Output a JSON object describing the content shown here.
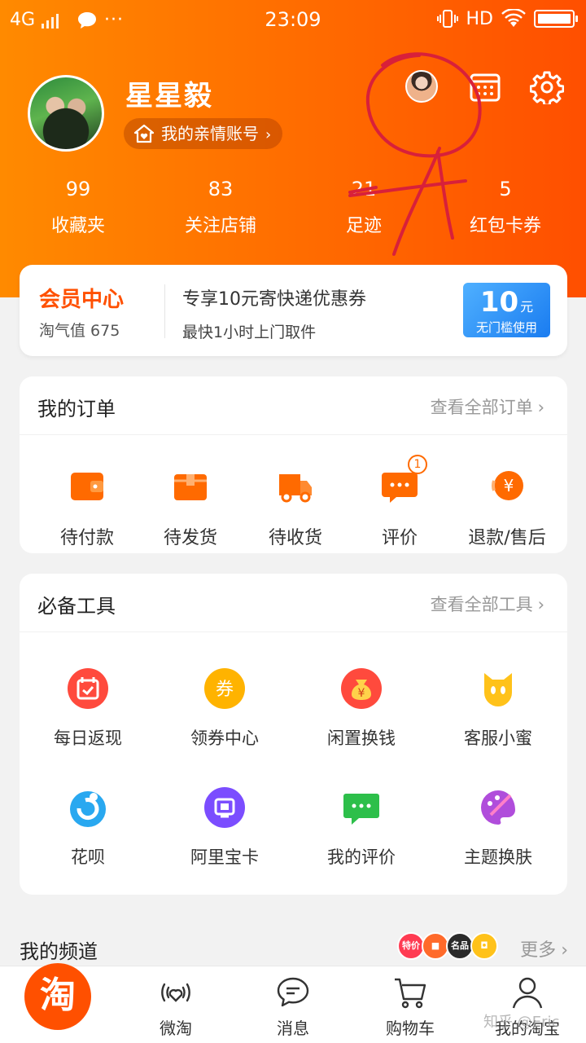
{
  "status_bar": {
    "network": "4G",
    "more": "···",
    "time": "23:09",
    "hd": "HD"
  },
  "profile": {
    "name": "星星毅",
    "family_account": "我的亲情账号",
    "chevron": "›"
  },
  "stats": [
    {
      "count": "99",
      "label": "收藏夹"
    },
    {
      "count": "83",
      "label": "关注店铺"
    },
    {
      "count": "21",
      "label": "足迹"
    },
    {
      "count": "5",
      "label": "红包卡券"
    }
  ],
  "member": {
    "title": "会员中心",
    "points": "淘气值 675",
    "promo_title": "专享10元寄快递优惠券",
    "promo_sub": "最快1小时上门取件",
    "coupon_value": "10",
    "coupon_unit": "元",
    "coupon_note": "无门槛使用"
  },
  "orders": {
    "title": "我的订单",
    "more": "查看全部订单",
    "chevron": "›",
    "items": [
      {
        "label": "待付款",
        "icon": "wallet-icon"
      },
      {
        "label": "待发货",
        "icon": "package-icon"
      },
      {
        "label": "待收货",
        "icon": "truck-icon"
      },
      {
        "label": "评价",
        "icon": "comment-icon",
        "badge": "1"
      },
      {
        "label": "退款/售后",
        "icon": "refund-icon"
      }
    ]
  },
  "tools": {
    "title": "必备工具",
    "more": "查看全部工具",
    "chevron": "›",
    "items": [
      {
        "label": "每日返现",
        "icon": "calendar-check-icon",
        "color": "#ff4a3d"
      },
      {
        "label": "领券中心",
        "icon": "coupon-icon",
        "color": "#ffb300",
        "glyph": "券"
      },
      {
        "label": "闲置换钱",
        "icon": "money-bag-icon",
        "color": "#ff4a3d",
        "glyph": "¥"
      },
      {
        "label": "客服小蜜",
        "icon": "assistant-icon",
        "color": "#ffc21a"
      },
      {
        "label": "花呗",
        "icon": "huabei-icon",
        "color": "#29a8f0"
      },
      {
        "label": "阿里宝卡",
        "icon": "sim-card-icon",
        "color": "#7b4dff"
      },
      {
        "label": "我的评价",
        "icon": "review-icon",
        "color": "#2dbf4a"
      },
      {
        "label": "主题换肤",
        "icon": "palette-icon",
        "color": "#b04ddb"
      }
    ]
  },
  "channels": {
    "title": "我的频道",
    "more": "更多",
    "chevron": "›",
    "chips": [
      {
        "label": "特价",
        "color": "#ff3b52"
      },
      {
        "label": "",
        "color": "#ff6a2a"
      },
      {
        "label": "名品",
        "color": "#2b2b2b"
      },
      {
        "label": "",
        "color": "#ffc21a"
      }
    ]
  },
  "tabbar": {
    "home_logo": "淘",
    "items": [
      {
        "label": "微淘",
        "icon": "weitao-icon"
      },
      {
        "label": "消息",
        "icon": "message-icon"
      },
      {
        "label": "购物车",
        "icon": "cart-icon"
      },
      {
        "label": "我的淘宝",
        "icon": "user-icon"
      }
    ]
  },
  "watermark": "知乎 @Eric",
  "colors": {
    "brand": "#ff5000",
    "header_start": "#ff8a00",
    "header_end": "#ff4f00",
    "coupon_blue": "#1a7cf0"
  }
}
